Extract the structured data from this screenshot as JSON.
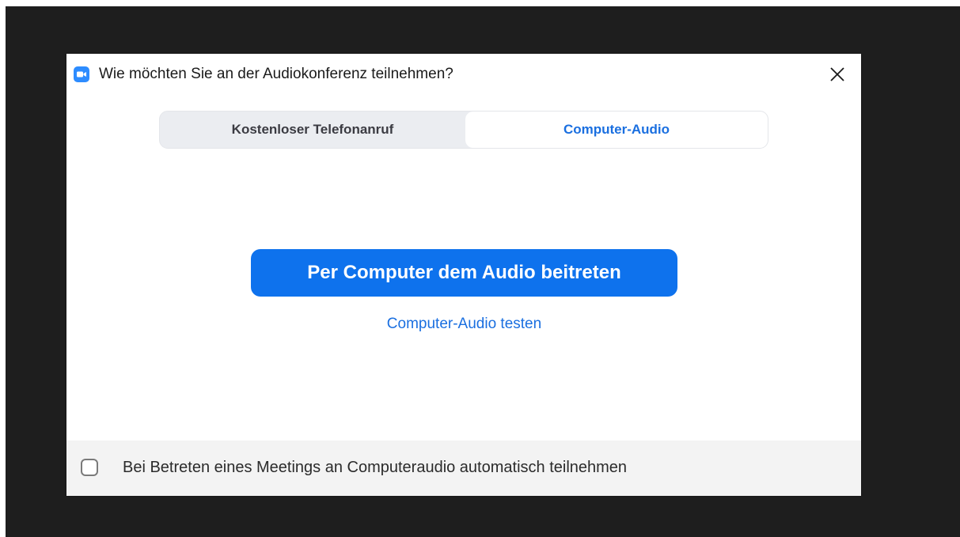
{
  "dialog": {
    "title": "Wie möchten Sie an der Audiokonferenz teilnehmen?",
    "app_icon": "zoom-camera-icon",
    "close_icon": "close-icon"
  },
  "tabs": [
    {
      "label": "Kostenloser Telefonanruf",
      "selected": false
    },
    {
      "label": "Computer-Audio",
      "selected": true
    }
  ],
  "main": {
    "join_button_label": "Per Computer dem Audio beitreten",
    "test_link_label": "Computer-Audio testen"
  },
  "footer": {
    "auto_join_label": "Bei Betreten eines Meetings an Computeraudio automatisch teilnehmen",
    "auto_join_checked": false
  },
  "colors": {
    "accent": "#0e72ed",
    "link": "#1a6fe0",
    "backdrop": "#1e1e1e",
    "tab_track": "#ebedf1",
    "footer_bg": "#f3f3f3"
  }
}
